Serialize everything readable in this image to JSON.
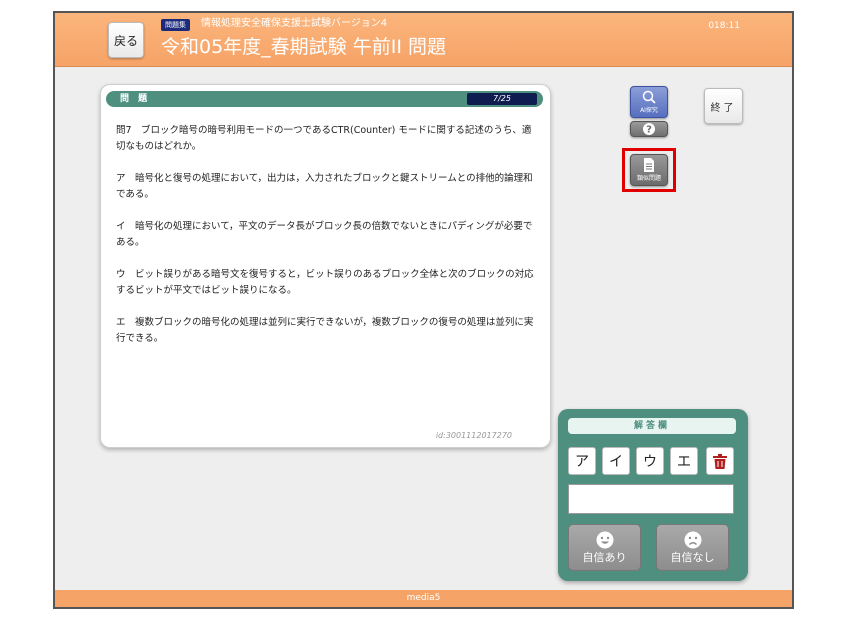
{
  "header": {
    "back_label": "戻る",
    "badge": "問題集",
    "subtitle": "情報処理安全確保支援士試験バージョン4",
    "title": "令和05年度_春期試験 午前II 問題",
    "clock": "018:11"
  },
  "question": {
    "panel_label": "問 題",
    "counter": "7/25",
    "text": "問7　ブロック暗号の暗号利用モードの一つであるCTR(Counter) モードに関する記述のうち、適切なものはどれか。",
    "options": [
      "ア　暗号化と復号の処理において，出力は，入力されたブロックと鍵ストリームとの排他的論理和である。",
      "イ　暗号化の処理において，平文のデータ長がブロック長の倍数でないときにパディングが必要である。",
      "ウ　ビット誤りがある暗号文を復号すると，ビット誤りのあるブロック全体と次のブロックの対応するビットが平文ではビット誤りになる。",
      "エ　複数ブロックの暗号化の処理は並列に実行できないが，複数ブロックの復号の処理は並列に実行できる。"
    ],
    "id": "id:3001112017270"
  },
  "tools": {
    "ai_label": "AI探究",
    "similar_label": "類似問題",
    "end_label": "終了",
    "ai_icon": "magnifier-icon",
    "help_icon": "question-icon",
    "similar_icon": "document-icon"
  },
  "answer": {
    "title": "解答欄",
    "choices": [
      "ア",
      "イ",
      "ウ",
      "エ"
    ],
    "delete_icon": "trash-icon",
    "value": "",
    "confident_label": "自信あり",
    "not_confident_label": "自信なし"
  },
  "footer": {
    "label": "media5"
  },
  "colors": {
    "header": "#f6a367",
    "panel_green": "#4e8f80",
    "counter_bg": "#0f1c4f",
    "highlight": "#e00000"
  }
}
